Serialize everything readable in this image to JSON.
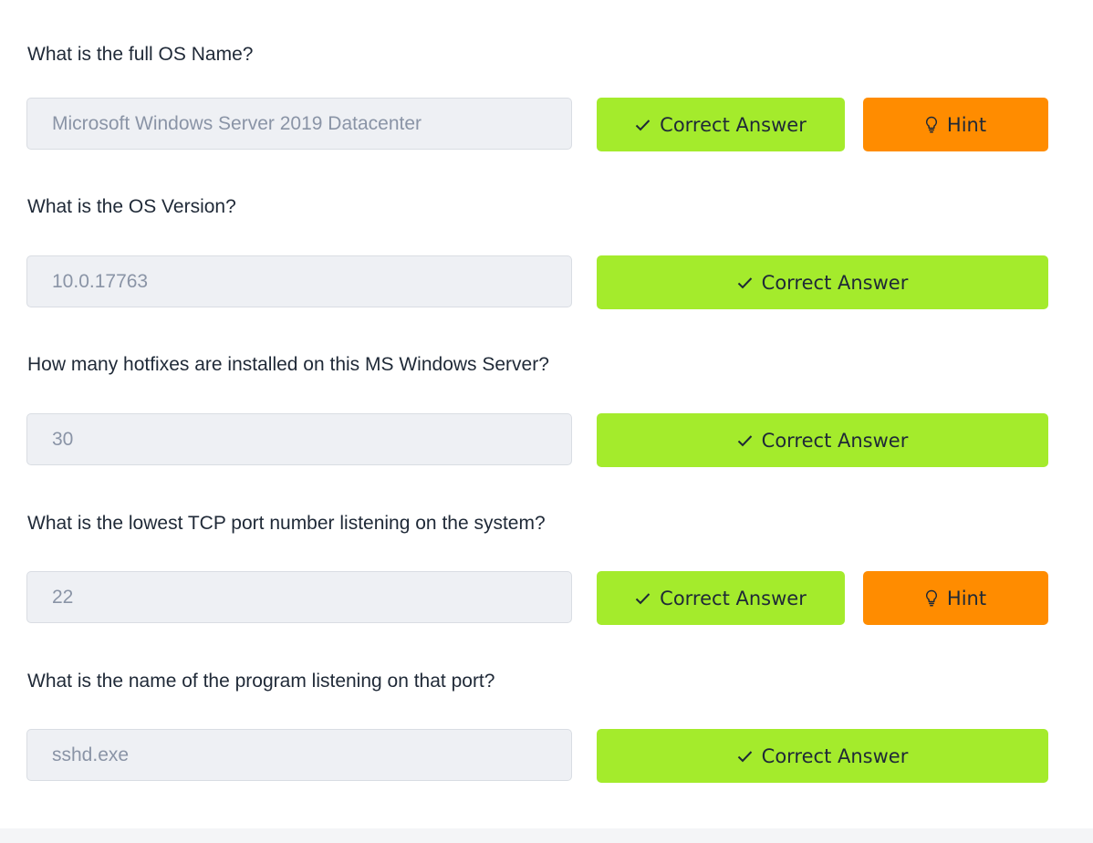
{
  "questions": [
    {
      "text": "What is the full OS Name?",
      "answer": "Microsoft Windows Server 2019 Datacenter",
      "correct_label": "Correct Answer",
      "hint_label": "Hint"
    },
    {
      "text": "What is the OS Version?",
      "answer": "10.0.17763",
      "correct_label": "Correct Answer"
    },
    {
      "text": "How many hotfixes are installed on this MS Windows Server?",
      "answer": "30",
      "correct_label": "Correct Answer"
    },
    {
      "text": "What is the lowest TCP port number listening on the system?",
      "answer": "22",
      "correct_label": "Correct Answer",
      "hint_label": "Hint"
    },
    {
      "text": "What is the name of the program listening on that port?",
      "answer": "sshd.exe",
      "correct_label": "Correct Answer"
    }
  ],
  "icons": {
    "correct": "check-icon",
    "hint": "lightbulb-icon"
  },
  "colors": {
    "correct_button": "#a4eb2c",
    "hint_button": "#ff8c00",
    "field_background": "#eef0f4",
    "question_text": "#1f2937",
    "answer_text": "#8a94a6"
  }
}
